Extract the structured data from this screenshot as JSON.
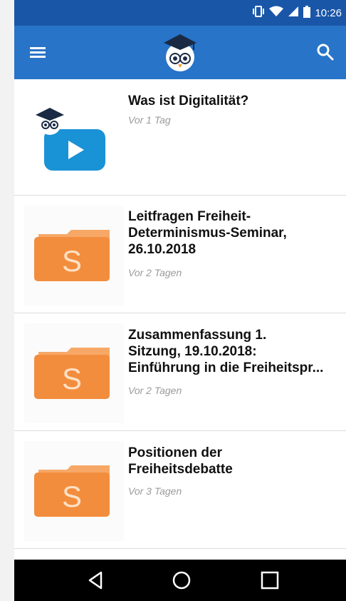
{
  "status_bar": {
    "time": "10:26",
    "icons": [
      "vibrate-icon",
      "wifi-icon",
      "signal-icon",
      "battery-icon"
    ]
  },
  "app_bar": {
    "menu_icon": "menu-icon",
    "logo": "owl-logo",
    "search_icon": "search-icon",
    "color": "#2874c8",
    "status_color": "#1a56a8"
  },
  "items": [
    {
      "title": "Was ist Digitalität?",
      "time": "Vor 1 Tag",
      "type": "video"
    },
    {
      "title": "Leitfragen Freiheit-\nDeterminismus-Seminar,\n26.10.2018",
      "time": "Vor 2 Tagen",
      "type": "folder",
      "letter": "S"
    },
    {
      "title": "Zusammenfassung 1.\nSitzung, 19.10.2018:\nEinführung in die Freiheitspr...",
      "time": "Vor 2 Tagen",
      "type": "folder",
      "letter": "S"
    },
    {
      "title": "Positionen der\nFreiheitsdebatte",
      "time": "Vor 3 Tagen",
      "type": "folder",
      "letter": "S"
    }
  ],
  "colors": {
    "folder": "#f28d3d",
    "folder_tab": "#f7a867",
    "video": "#1a92d6"
  },
  "nav_bar": {
    "buttons": [
      "back-icon",
      "home-icon",
      "recents-icon"
    ]
  }
}
